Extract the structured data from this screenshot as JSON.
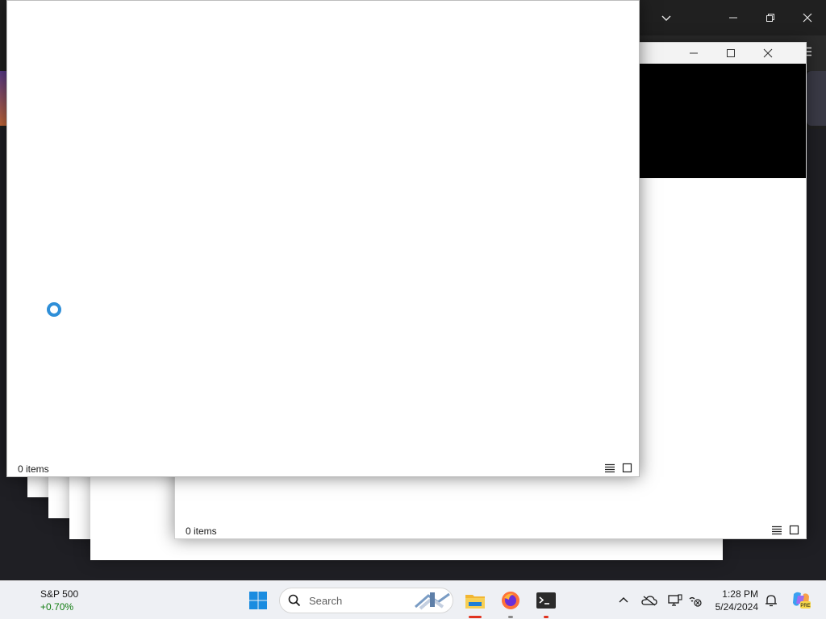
{
  "background_window": {
    "controls": {
      "chevron": "chevron-down-icon",
      "minimize": "minimize-icon",
      "restore": "restore-icon",
      "close": "close-icon",
      "menu": "hamburger-menu-icon"
    }
  },
  "explorer_back": {
    "status": "0 items",
    "controls": [
      "minimize-icon",
      "maximize-icon",
      "close-icon"
    ],
    "view_icons": [
      "details-view-icon",
      "tiles-view-icon"
    ]
  },
  "explorer_front": {
    "status": "0 items",
    "loading_indicator": "loading-spinner-icon",
    "view_icons": [
      "details-view-icon",
      "tiles-view-icon"
    ]
  },
  "taskbar": {
    "widget": {
      "title": "S&P 500",
      "change": "+0.70%",
      "change_color": "#107c10"
    },
    "search": {
      "placeholder": "Search"
    },
    "apps": [
      {
        "name": "file-explorer-icon",
        "indicator_color": "#e0331f"
      },
      {
        "name": "firefox-icon",
        "indicator_color": "#8a8a8a"
      },
      {
        "name": "terminal-icon",
        "indicator_color": "#e0331f"
      }
    ],
    "tray": [
      "chevron-up-icon",
      "onedrive-icon",
      "device-icon",
      "network-icon"
    ],
    "clock": {
      "time": "1:28 PM",
      "date": "5/24/2024"
    },
    "notification_icon": "notification-icon",
    "copilot_icon": "copilot-icon",
    "accent_color": "#0078d4"
  }
}
